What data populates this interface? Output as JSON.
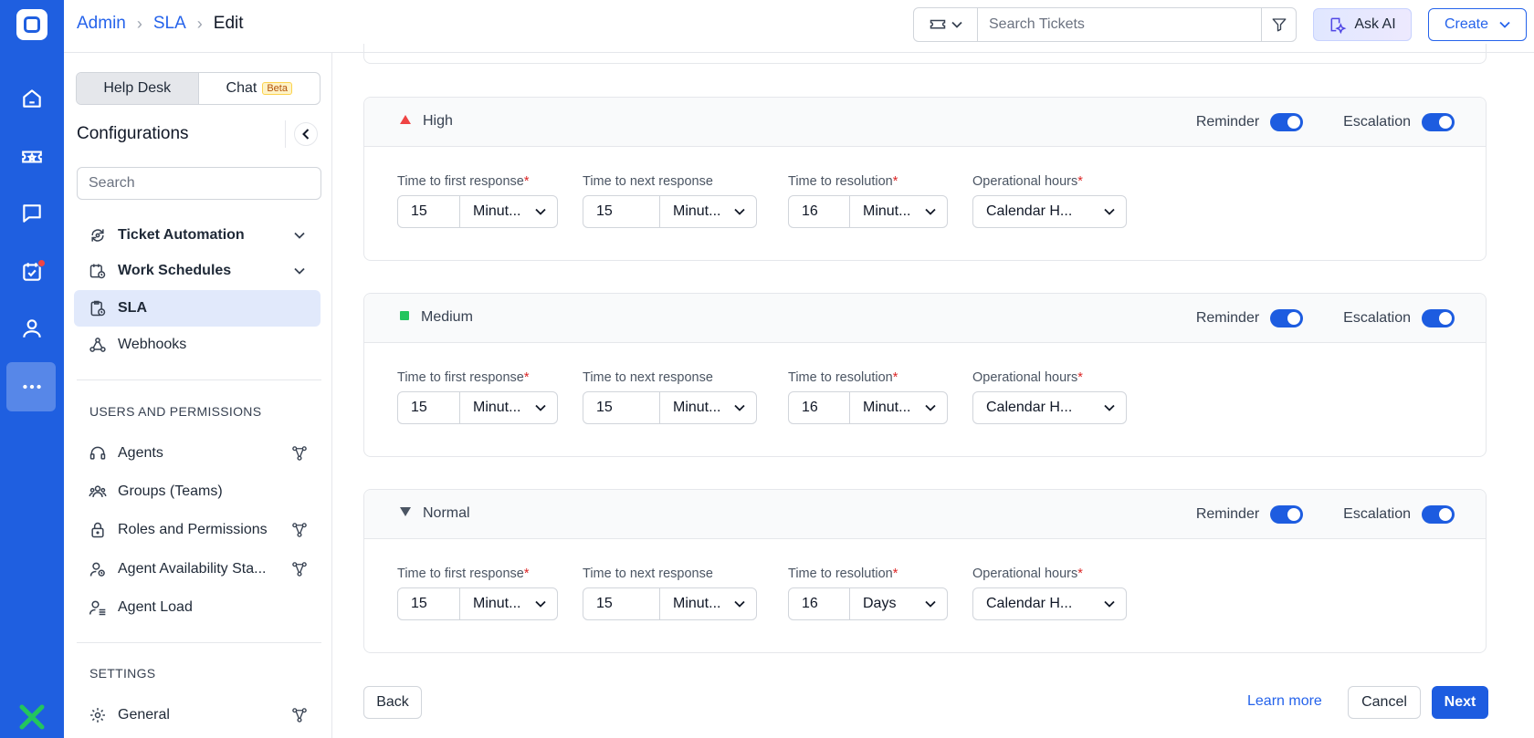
{
  "breadcrumb": {
    "items": [
      "Admin",
      "SLA"
    ],
    "current": "Edit"
  },
  "topbar": {
    "search_placeholder": "Search Tickets",
    "ask_ai_label": "Ask AI",
    "create_label": "Create"
  },
  "sidebar": {
    "tabs": {
      "helpdesk": "Help Desk",
      "chat": "Chat",
      "chat_badge": "Beta"
    },
    "title": "Configurations",
    "search_placeholder": "Search",
    "config_items": [
      {
        "label": "Ticket Automation",
        "icon": "automation-icon",
        "expandable": true
      },
      {
        "label": "Work Schedules",
        "icon": "calendar-clock-icon",
        "expandable": true
      },
      {
        "label": "SLA",
        "icon": "sla-clipboard-icon",
        "active": true
      },
      {
        "label": "Webhooks",
        "icon": "webhook-icon"
      }
    ],
    "users_section": {
      "label": "USERS AND PERMISSIONS",
      "items": [
        {
          "label": "Agents",
          "icon": "headset-icon",
          "trail": "hierarchy-icon"
        },
        {
          "label": "Groups (Teams)",
          "icon": "group-icon"
        },
        {
          "label": "Roles and Permissions",
          "icon": "lock-icon",
          "trail": "hierarchy-icon"
        },
        {
          "label": "Agent Availability Sta...",
          "icon": "user-status-icon",
          "trail": "hierarchy-icon"
        },
        {
          "label": "Agent Load",
          "icon": "user-list-icon"
        }
      ]
    },
    "settings_section": {
      "label": "SETTINGS",
      "items": [
        {
          "label": "General",
          "icon": "gear-icon",
          "trail": "hierarchy-icon"
        }
      ]
    }
  },
  "labels": {
    "first_response": "Time to first response",
    "next_response": "Time to next response",
    "resolution": "Time to resolution",
    "operational_hours": "Operational hours",
    "reminder": "Reminder",
    "escalation": "Escalation",
    "required_mark": "*"
  },
  "priorities": [
    {
      "name": "High",
      "marker": "triangle-up",
      "color": "#ef4444",
      "reminder": true,
      "escalation": true,
      "first_response": {
        "value": "15",
        "unit": "Minut..."
      },
      "next_response": {
        "value": "15",
        "unit": "Minut..."
      },
      "resolution": {
        "value": "16",
        "unit": "Minut..."
      },
      "operational_hours": "Calendar H..."
    },
    {
      "name": "Medium",
      "marker": "square",
      "color": "#22c55e",
      "reminder": true,
      "escalation": true,
      "first_response": {
        "value": "15",
        "unit": "Minut..."
      },
      "next_response": {
        "value": "15",
        "unit": "Minut..."
      },
      "resolution": {
        "value": "16",
        "unit": "Minut..."
      },
      "operational_hours": "Calendar H..."
    },
    {
      "name": "Normal",
      "marker": "triangle-down",
      "color": "#4b5563",
      "reminder": true,
      "escalation": true,
      "first_response": {
        "value": "15",
        "unit": "Minut..."
      },
      "next_response": {
        "value": "15",
        "unit": "Minut..."
      },
      "resolution": {
        "value": "16",
        "unit": "Days"
      },
      "operational_hours": "Calendar H..."
    }
  ],
  "footer": {
    "back": "Back",
    "learn_more": "Learn more",
    "cancel": "Cancel",
    "next": "Next"
  },
  "colors": {
    "brand": "#1f5fe0",
    "accent": "#1d5ce0",
    "link": "#2563eb"
  }
}
